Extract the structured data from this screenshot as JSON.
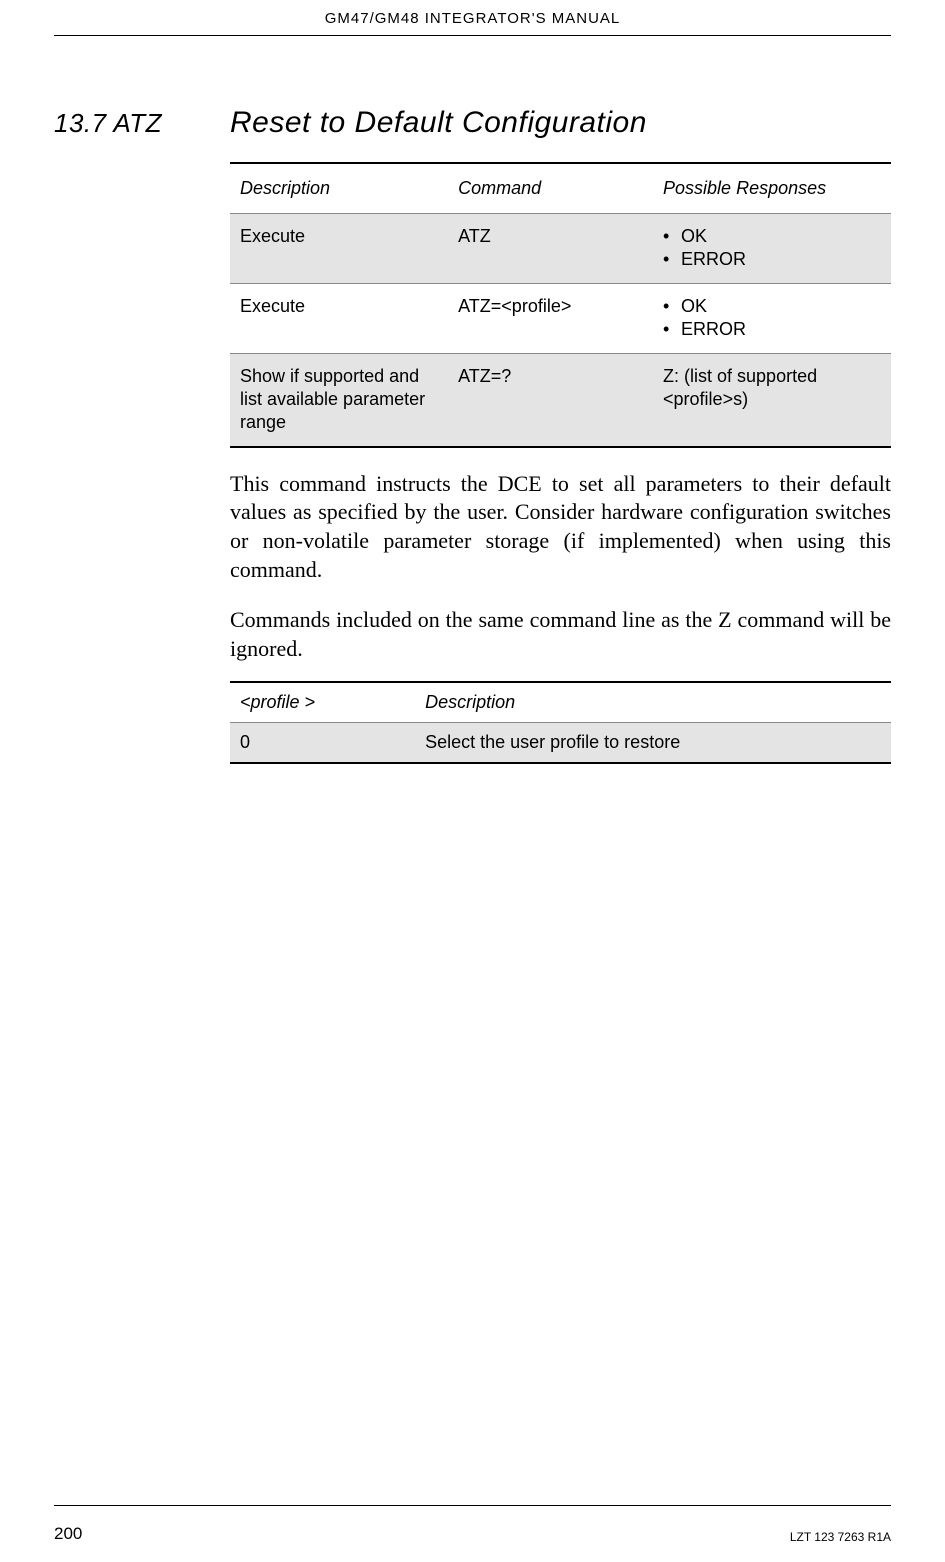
{
  "header": {
    "title": "GM47/GM48 INTEGRATOR'S MANUAL"
  },
  "section": {
    "number": "13.7 ATZ",
    "title": "Reset to Default Configuration"
  },
  "table1": {
    "headers": {
      "c1": "Description",
      "c2": "Command",
      "c3": "Possible Responses"
    },
    "rows": [
      {
        "desc": "Execute",
        "cmd": "ATZ",
        "resp": [
          "OK",
          "ERROR"
        ],
        "shaded": true
      },
      {
        "desc": "Execute",
        "cmd": "ATZ=<profile>",
        "resp": [
          "OK",
          "ERROR"
        ],
        "shaded": false
      },
      {
        "desc": "Show if supported and list available parameter range",
        "cmd": "ATZ=?",
        "resp_text": "Z: (list of supported <profile>s)",
        "shaded": true
      }
    ]
  },
  "paragraphs": {
    "p1": "This command instructs the DCE to set all parameters to their default values as specified by the user. Consider hardware configuration switches or non-volatile parameter storage (if implemented) when using this command.",
    "p2": "Commands included on the same command line as the Z command will be ignored."
  },
  "table2": {
    "headers": {
      "c1": "<profile >",
      "c2": "Description"
    },
    "rows": [
      {
        "val": "0",
        "desc": "Select the user profile to restore"
      }
    ]
  },
  "footer": {
    "page": "200",
    "doc": "LZT 123 7263 R1A"
  }
}
